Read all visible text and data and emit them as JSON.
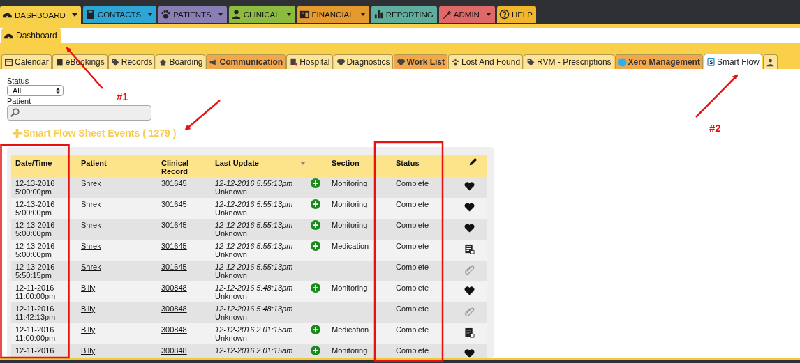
{
  "nav_tabs": [
    {
      "label": "DASHBOARD",
      "selected": true,
      "dropdown": true,
      "color": "#f7d04b"
    },
    {
      "label": "CONTACTS",
      "selected": false,
      "dropdown": true,
      "color": "#2da6d5"
    },
    {
      "label": "PATIENTS",
      "selected": false,
      "dropdown": true,
      "color": "#8a7fb5"
    },
    {
      "label": "CLINICAL",
      "selected": false,
      "dropdown": true,
      "color": "#8cbb40"
    },
    {
      "label": "FINANCIAL",
      "selected": false,
      "dropdown": true,
      "color": "#e49a2e"
    },
    {
      "label": "REPORTING",
      "selected": false,
      "dropdown": false,
      "color": "#5fae9d"
    },
    {
      "label": "ADMIN",
      "selected": false,
      "dropdown": true,
      "color": "#df6868"
    },
    {
      "label": "HELP",
      "selected": false,
      "dropdown": false,
      "color": "#f1b62d"
    }
  ],
  "page_tab": {
    "label": "Dashboard"
  },
  "sub_tabs": [
    {
      "label": "Calendar",
      "selected": false,
      "highlight": false
    },
    {
      "label": "eBookings",
      "selected": false,
      "highlight": false
    },
    {
      "label": "Records",
      "selected": false,
      "highlight": false
    },
    {
      "label": "Boarding",
      "selected": false,
      "highlight": false
    },
    {
      "label": "Communication",
      "selected": false,
      "highlight": true
    },
    {
      "label": "Hospital",
      "selected": false,
      "highlight": false
    },
    {
      "label": "Diagnostics",
      "selected": false,
      "highlight": false
    },
    {
      "label": "Work List",
      "selected": false,
      "highlight": true
    },
    {
      "label": "Lost And Found",
      "selected": false,
      "highlight": false
    },
    {
      "label": "RVM - Prescriptions",
      "selected": false,
      "highlight": false
    },
    {
      "label": "Xero Management",
      "selected": false,
      "highlight": true
    },
    {
      "label": "Smart Flow",
      "selected": true,
      "highlight": false
    },
    {
      "selected": false,
      "highlight": false
    }
  ],
  "filters": {
    "status_label": "Status",
    "status_value": "All",
    "patient_label": "Patient"
  },
  "section_title": "Smart Flow Sheet Events ( 1279 )",
  "table": {
    "columns": [
      "Date/Time",
      "Patient",
      "Clinical Record",
      "Last Update",
      "Section",
      "Status"
    ],
    "rows": [
      {
        "date": "12-13-2016",
        "time": "5:00:00pm",
        "patient": "Shrek",
        "record": "301645",
        "updated": "12-12-2016 5:55:13pm",
        "by": "Unknown",
        "section_icon": true,
        "section": "Monitoring",
        "status": "Complete",
        "kind": "heart"
      },
      {
        "date": "12-13-2016",
        "time": "5:00:00pm",
        "patient": "Shrek",
        "record": "301645",
        "updated": "12-12-2016 5:55:13pm",
        "by": "Unknown",
        "section_icon": true,
        "section": "Monitoring",
        "status": "Complete",
        "kind": "heart"
      },
      {
        "date": "12-13-2016",
        "time": "5:00:00pm",
        "patient": "Shrek",
        "record": "301645",
        "updated": "12-12-2016 5:55:13pm",
        "by": "Unknown",
        "section_icon": true,
        "section": "Monitoring",
        "status": "Complete",
        "kind": "heart"
      },
      {
        "date": "12-13-2016",
        "time": "5:00:00pm",
        "patient": "Shrek",
        "record": "301645",
        "updated": "12-12-2016 5:55:13pm",
        "by": "Unknown",
        "section_icon": true,
        "section": "Medication",
        "status": "Complete",
        "kind": "sheet"
      },
      {
        "date": "12-13-2016",
        "time": "5:50:15pm",
        "patient": "Shrek",
        "record": "301645",
        "updated": "12-12-2016 5:55:13pm",
        "by": "Unknown",
        "section_icon": false,
        "status": "Complete",
        "kind": "clip"
      },
      {
        "date": "12-11-2016",
        "time": "11:00:00pm",
        "patient": "Billy",
        "record": "300848",
        "updated": "12-12-2016 5:48:13pm",
        "by": "Unknown",
        "section_icon": true,
        "section": "Monitoring",
        "status": "Complete",
        "kind": "heart"
      },
      {
        "date": "12-11-2016",
        "time": "11:42:13pm",
        "patient": "Billy",
        "record": "300848",
        "updated": "12-12-2016 5:48:13pm",
        "by": "Unknown",
        "section_icon": false,
        "status": "Complete",
        "kind": "clip"
      },
      {
        "date": "12-11-2016",
        "time": "11:00:00pm",
        "patient": "Billy",
        "record": "300848",
        "updated": "12-12-2016 2:01:15am",
        "by": "Unknown",
        "section_icon": true,
        "section": "Medication",
        "status": "Complete",
        "kind": "sheet"
      },
      {
        "date": "12-11-2016",
        "patient": "Billy",
        "record": "300848",
        "updated": "12-12-2016 2:01:15am",
        "section_icon": true,
        "section": "Monitoring",
        "status": "Complete",
        "kind": "heart"
      }
    ]
  },
  "annotations": [
    {
      "text": "#1"
    },
    {
      "text": "#2"
    }
  ]
}
